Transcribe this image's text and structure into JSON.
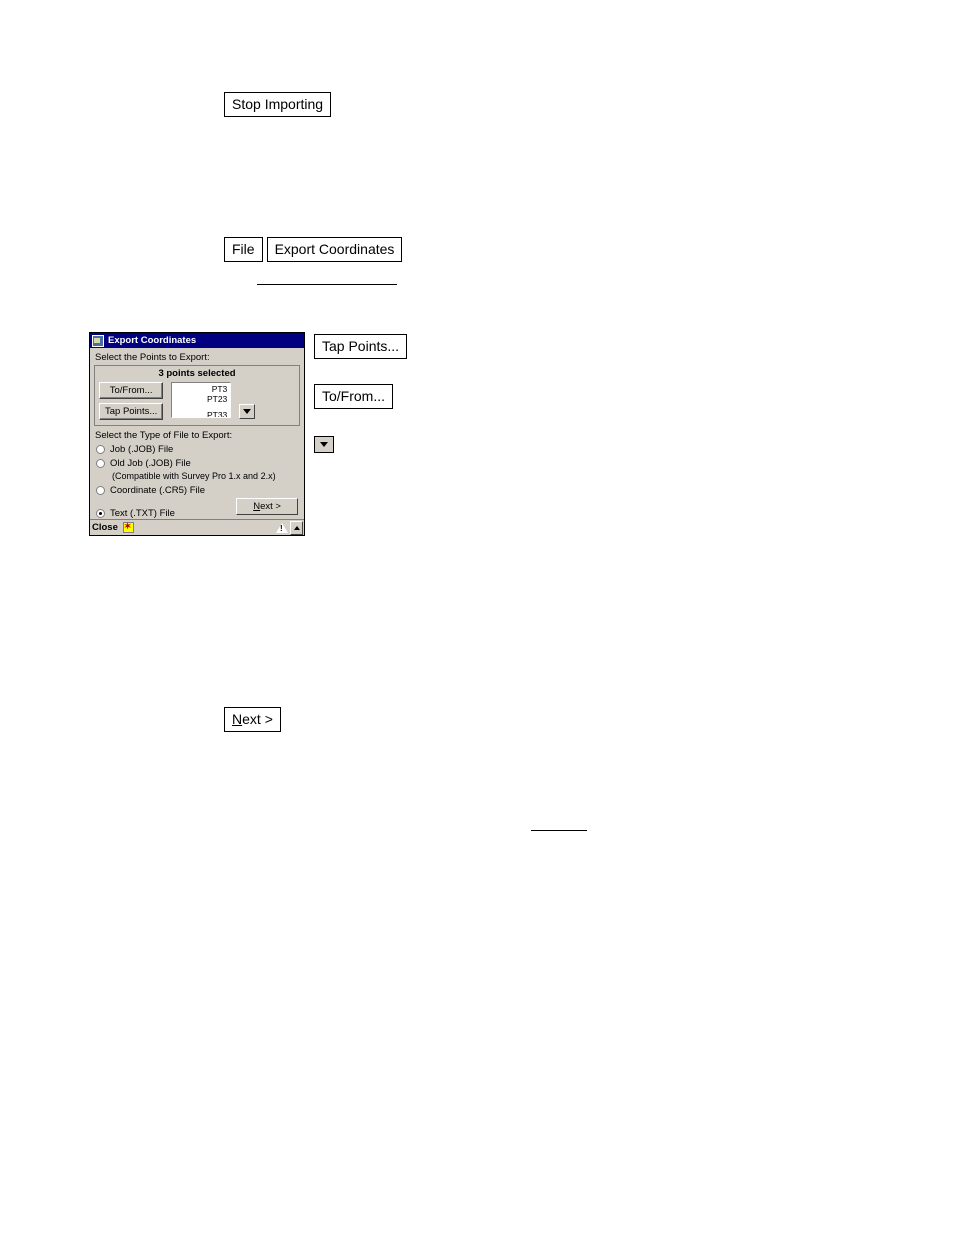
{
  "page": {
    "callouts": {
      "stop_importing": "Stop Importing",
      "file": "File",
      "export_coordinates": "Export Coordinates",
      "tap_points": "Tap Points...",
      "to_from": "To/From...",
      "next": "Next >",
      "next_underline": "N",
      "next_rest": "ext >"
    }
  },
  "dialog": {
    "title": "Export Coordinates",
    "title_icon": "app-icon",
    "points_label": "Select the Points to Export:",
    "points_group": {
      "heading": "3 points selected",
      "buttons": [
        {
          "label": "To/From...",
          "underline": ""
        },
        {
          "label": "Tap Points...",
          "underline": ""
        }
      ],
      "list_items": [
        "PT3",
        "PT23"
      ],
      "list_clipped": "PT33",
      "spinner_icon": "chevron-down-icon"
    },
    "file_type_label": "Select the Type of File to Export:",
    "file_types": [
      {
        "label": "Job (.JOB) File",
        "selected": false,
        "note": ""
      },
      {
        "label": "Old Job (.JOB) File",
        "selected": false,
        "note": "(Compatible with Survey Pro 1.x and 2.x)"
      },
      {
        "label": "Coordinate (.CR5) File",
        "selected": false,
        "note": ""
      },
      {
        "label": "Text (.TXT) File",
        "selected": true,
        "note": ""
      }
    ],
    "next_button": {
      "underline": "N",
      "rest": "ext >"
    },
    "statusbar": {
      "close_label": "Close",
      "close_icon": "star-icon",
      "warning_icon": "warning-triangle-icon",
      "scroll_icon": "scroll-up-icon"
    }
  }
}
